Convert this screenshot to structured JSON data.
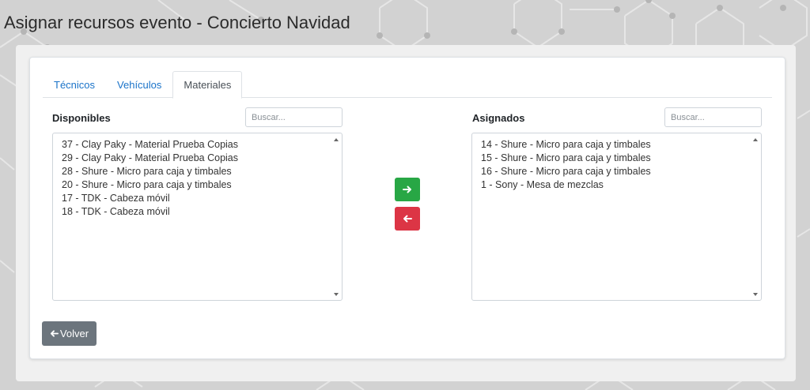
{
  "page": {
    "title": "Asignar recursos evento - Concierto Navidad"
  },
  "tabs": [
    {
      "label": "Técnicos",
      "active": false
    },
    {
      "label": "Vehículos",
      "active": false
    },
    {
      "label": "Materiales",
      "active": true
    }
  ],
  "available": {
    "label": "Disponibles",
    "search_placeholder": "Buscar...",
    "items": [
      "37 - Clay Paky - Material Prueba Copias",
      "29 - Clay Paky - Material Prueba Copias",
      "28 - Shure - Micro para caja y timbales",
      "20 - Shure - Micro para caja y timbales",
      "17 - TDK - Cabeza móvil",
      "18 - TDK - Cabeza móvil"
    ]
  },
  "assigned": {
    "label": "Asignados",
    "search_placeholder": "Buscar...",
    "items": [
      "14 - Shure - Micro para caja y timbales",
      "15 - Shure - Micro para caja y timbales",
      "16 - Shure - Micro para caja y timbales",
      "1 - Sony - Mesa de mezclas"
    ]
  },
  "actions": {
    "assign_icon": "arrow-right-icon",
    "unassign_icon": "arrow-left-icon",
    "assign_color": "#28a745",
    "unassign_color": "#dc3545",
    "back_label": "Volver",
    "back_icon": "arrow-left-icon"
  }
}
